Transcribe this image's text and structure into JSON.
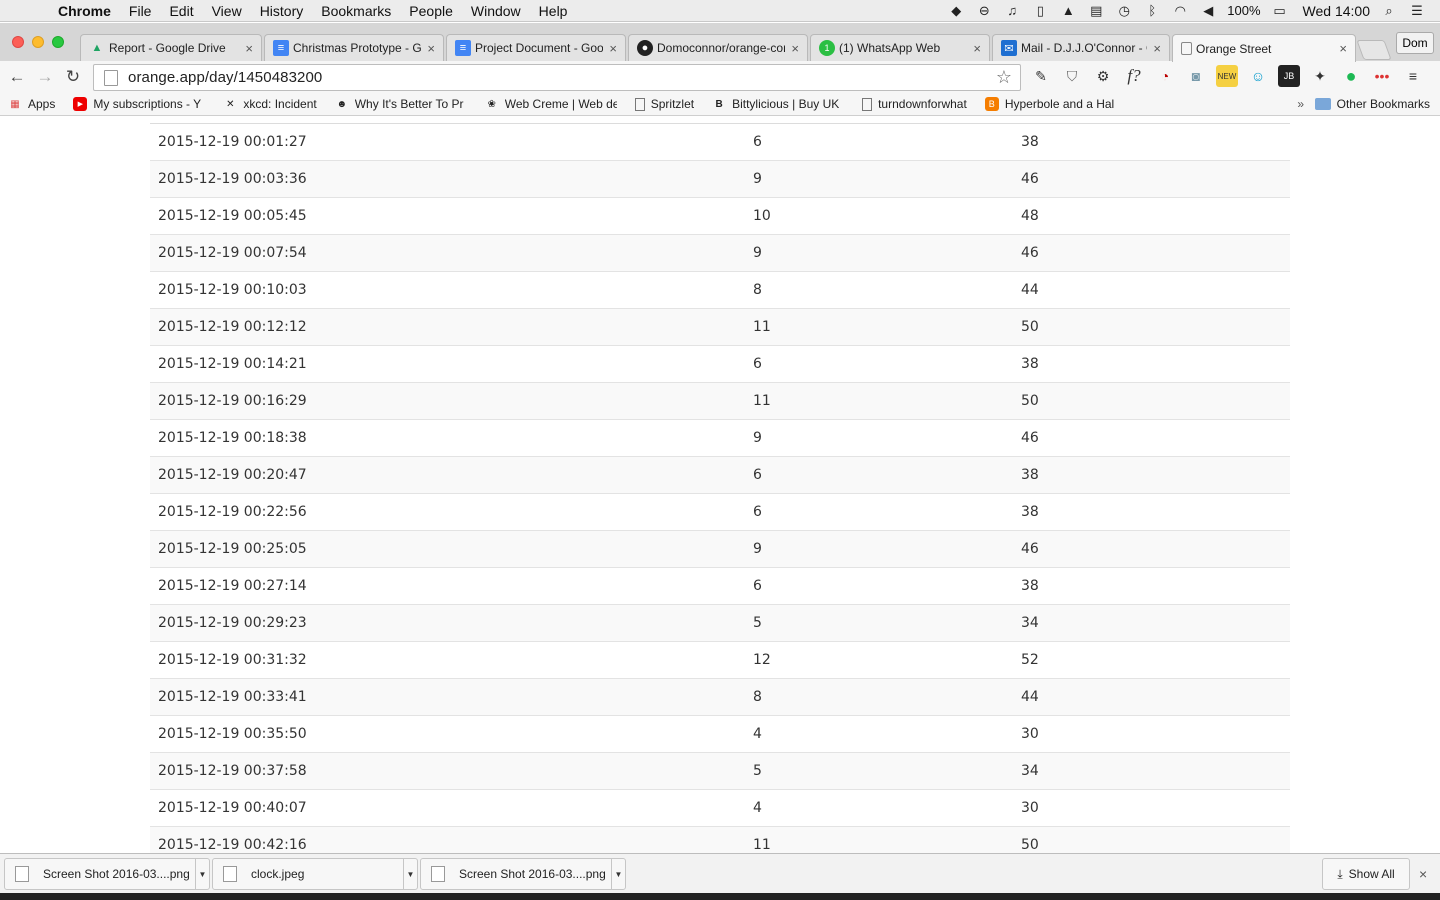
{
  "menubar": {
    "app": "Chrome",
    "items": [
      "File",
      "Edit",
      "View",
      "History",
      "Bookmarks",
      "People",
      "Window",
      "Help"
    ],
    "battery": "100%",
    "clock": "Wed 14:00"
  },
  "tabs": [
    {
      "title": "Report - Google Drive",
      "icon": "google-drive-icon"
    },
    {
      "title": "Christmas Prototype - G",
      "icon": "google-docs-icon"
    },
    {
      "title": "Project Document - Goo",
      "icon": "google-docs-icon"
    },
    {
      "title": "Domoconnor/orange-cor",
      "icon": "github-icon"
    },
    {
      "title": "(1) WhatsApp Web",
      "icon": "whatsapp-icon"
    },
    {
      "title": "Mail - D.J.J.O'Connor - C",
      "icon": "mail-icon"
    },
    {
      "title": "Orange Street",
      "icon": "page-icon"
    }
  ],
  "profile": "Dom",
  "address": {
    "url": "orange.app/day/1450483200"
  },
  "bookmarks": [
    {
      "label": "Apps",
      "icon": "apps-grid-icon"
    },
    {
      "label": "My subscriptions - Y",
      "icon": "youtube-icon"
    },
    {
      "label": "xkcd: Incident",
      "icon": "xkcd-icon"
    },
    {
      "label": "Why It's Better To Pr",
      "icon": "smiley-icon"
    },
    {
      "label": "Web Creme | Web de",
      "icon": "webcreme-icon"
    },
    {
      "label": "Spritzlet",
      "icon": "page-icon"
    },
    {
      "label": "Bittylicious | Buy UK",
      "icon": "bitcoin-icon"
    },
    {
      "label": "turndownforwhat",
      "icon": "page-icon"
    },
    {
      "label": "Hyperbole and a Hal",
      "icon": "blogger-icon"
    }
  ],
  "bookmarks_more": "»",
  "other_bookmarks": "Other Bookmarks",
  "table": {
    "rows": [
      [
        "2015-12-19 00:01:27",
        "6",
        "38"
      ],
      [
        "2015-12-19 00:03:36",
        "9",
        "46"
      ],
      [
        "2015-12-19 00:05:45",
        "10",
        "48"
      ],
      [
        "2015-12-19 00:07:54",
        "9",
        "46"
      ],
      [
        "2015-12-19 00:10:03",
        "8",
        "44"
      ],
      [
        "2015-12-19 00:12:12",
        "11",
        "50"
      ],
      [
        "2015-12-19 00:14:21",
        "6",
        "38"
      ],
      [
        "2015-12-19 00:16:29",
        "11",
        "50"
      ],
      [
        "2015-12-19 00:18:38",
        "9",
        "46"
      ],
      [
        "2015-12-19 00:20:47",
        "6",
        "38"
      ],
      [
        "2015-12-19 00:22:56",
        "6",
        "38"
      ],
      [
        "2015-12-19 00:25:05",
        "9",
        "46"
      ],
      [
        "2015-12-19 00:27:14",
        "6",
        "38"
      ],
      [
        "2015-12-19 00:29:23",
        "5",
        "34"
      ],
      [
        "2015-12-19 00:31:32",
        "12",
        "52"
      ],
      [
        "2015-12-19 00:33:41",
        "8",
        "44"
      ],
      [
        "2015-12-19 00:35:50",
        "4",
        "30"
      ],
      [
        "2015-12-19 00:37:58",
        "5",
        "34"
      ],
      [
        "2015-12-19 00:40:07",
        "4",
        "30"
      ],
      [
        "2015-12-19 00:42:16",
        "11",
        "50"
      ]
    ]
  },
  "downloads": {
    "items": [
      "Screen Shot 2016-03....png",
      "clock.jpeg",
      "Screen Shot 2016-03....png"
    ],
    "show_all": "Show All"
  }
}
